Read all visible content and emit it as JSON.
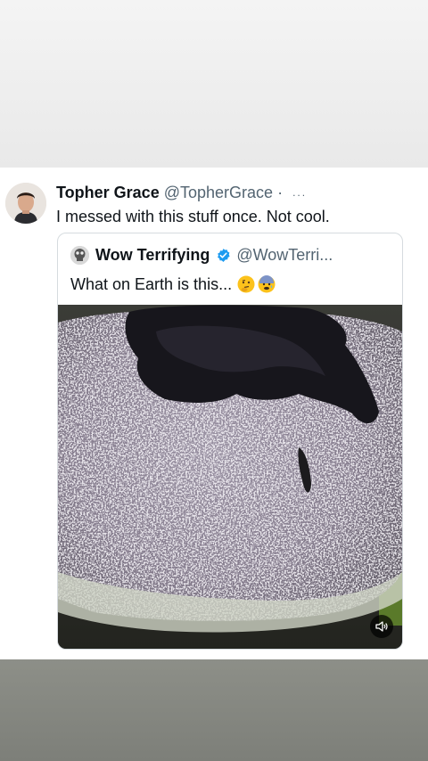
{
  "tweet": {
    "author_name": "Topher Grace",
    "author_handle": "@TopherGrace",
    "separator": "·",
    "more": "...",
    "text": "I messed with this stuff once.  Not cool."
  },
  "quoted_tweet": {
    "author_name": "Wow Terrifying",
    "author_handle": "@WowTerri...",
    "text": "What on Earth is this...",
    "emojis": [
      "thinking-face-emoji",
      "anxious-face-emoji"
    ]
  },
  "media": {
    "icons": [
      "speaker-icon"
    ]
  },
  "colors": {
    "verified_blue": "#1d9bf0",
    "text_primary": "#0f1419",
    "text_secondary": "#536471"
  }
}
